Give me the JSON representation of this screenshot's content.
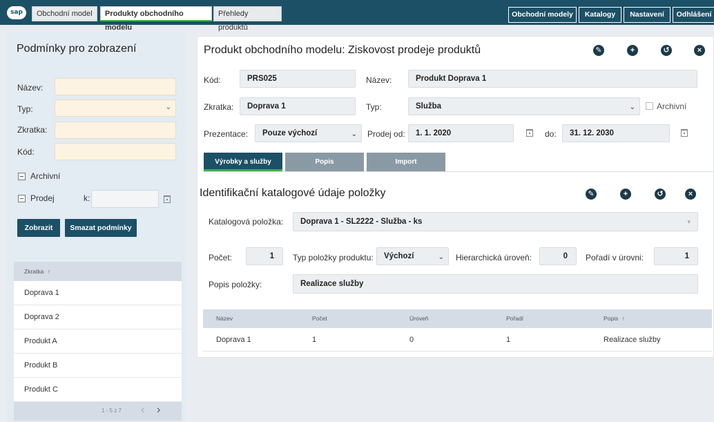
{
  "app": {
    "logo": "sap"
  },
  "tabs": [
    {
      "label": "Obchodní model"
    },
    {
      "label": "Produkty obchodního modelu"
    },
    {
      "label": "Přehledy produktů"
    }
  ],
  "topnav": [
    {
      "label": "Obchodní modely"
    },
    {
      "label": "Katalogy"
    },
    {
      "label": "Nastavení"
    },
    {
      "label": "Odhlášení"
    }
  ],
  "filters": {
    "title": "Podmínky pro zobrazení",
    "nazev_label": "Název:",
    "typ_label": "Typ:",
    "zkratka_label": "Zkratka:",
    "kod_label": "Kód:",
    "archivni_label": "Archivní",
    "prodej_label": "Prodej",
    "k_label": "k:",
    "show_button": "Zobrazit",
    "clear_button": "Smazat podmínky"
  },
  "left_table": {
    "header": "Zkratka",
    "sort_icon": "↑",
    "rows": [
      "Doprava 1",
      "Doprava 2",
      "Produkt A",
      "Produkt B",
      "Produkt C"
    ],
    "pager": "1 - 5 z 7",
    "prev_icon": "‹",
    "next_icon": "›"
  },
  "main": {
    "title": "Produkt obchodního modelu: Ziskovost prodeje produktů",
    "kod_label": "Kód:",
    "kod": "PRS025",
    "nazev_label": "Název:",
    "nazev": "Produkt Doprava 1",
    "zkratka_label": "Zkratka:",
    "zkratka": "Doprava 1",
    "typ_label": "Typ:",
    "typ": "Služba",
    "archivni_label": "Archivní",
    "prezentace_label": "Prezentace:",
    "prezentace": "Pouze výchozí",
    "prodej_od_label": "Prodej od:",
    "prodej_od": "1. 1. 2020",
    "do_label": "do:",
    "do": "31. 12. 2030"
  },
  "subtabs": [
    {
      "label": "Výrobky a služby"
    },
    {
      "label": "Popis"
    },
    {
      "label": "Import"
    }
  ],
  "sub": {
    "title": "Identifikační katalogové údaje položky",
    "katalog_label": "Katalogová položka:",
    "katalog": "Doprava 1 - SL2222 - Služba - ks",
    "pocet_label": "Počet:",
    "pocet": "1",
    "typ_polozky_label": "Typ položky produktu:",
    "typ_polozky": "Výchozí",
    "hier_label": "Hierarchická úroveň:",
    "hier": "0",
    "poradi_label": "Pořadí v úrovni:",
    "poradi": "1",
    "popis_label": "Popis položky:",
    "popis": "Realizace služby"
  },
  "items_table": {
    "columns": [
      "Název",
      "Počet",
      "Úroveň",
      "Pořadí",
      "Popis"
    ],
    "sort_icon": "↑",
    "rows": [
      {
        "nazev": "Doprava 1",
        "pocet": "1",
        "uroven": "0",
        "poradi": "1",
        "popis": "Realizace služby"
      }
    ]
  },
  "icons": {
    "edit": "✎",
    "add": "+",
    "history": "↺",
    "close": "×",
    "chevron": "⌄",
    "dropdown": "▾"
  },
  "colors": {
    "brand": "#1c5066",
    "accent": "#3cb14a",
    "input_bg": "#fdf3e2"
  }
}
